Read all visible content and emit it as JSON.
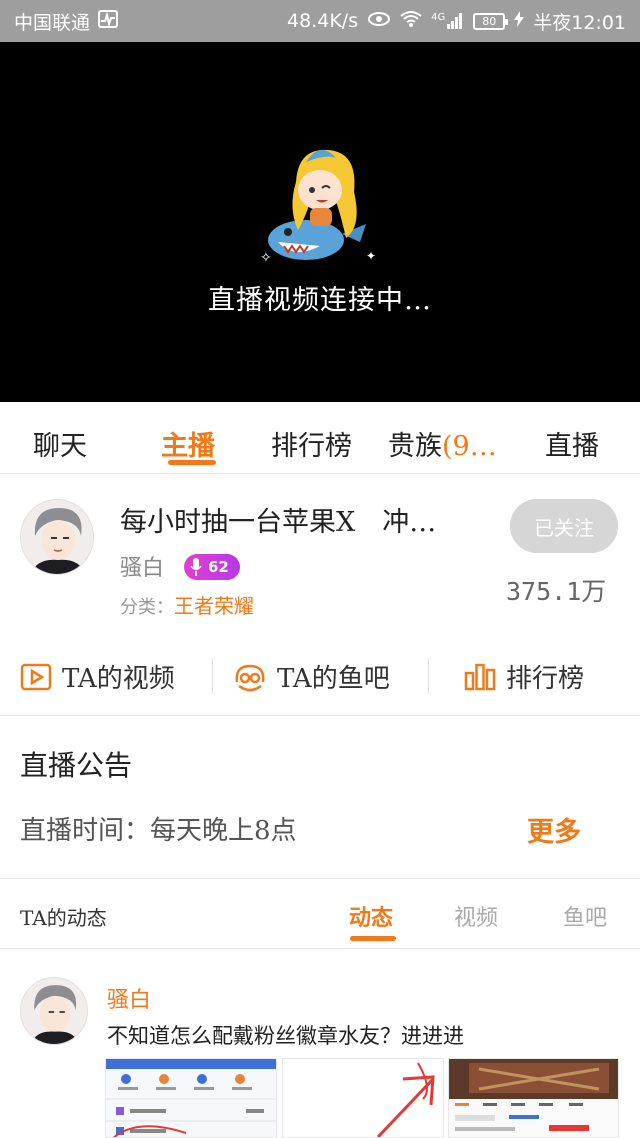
{
  "status_bar": {
    "carrier": "中国联通",
    "speed": "48.4K/s",
    "network": "4G",
    "battery": "80",
    "time": "半夜12:01"
  },
  "video": {
    "loading_text": "直播视频连接中…"
  },
  "tabs": [
    {
      "label": "聊天"
    },
    {
      "label": "主播"
    },
    {
      "label": "排行榜"
    },
    {
      "label": "贵族",
      "suffix": "(9…"
    },
    {
      "label": "直播"
    }
  ],
  "anchor": {
    "title": "每小时抽一台苹果X　冲…",
    "name": "骚白",
    "level": "62",
    "category_label": "分类：",
    "category_value": "王者荣耀",
    "follow_label": "已关注",
    "fans": "375.1万"
  },
  "actions": [
    {
      "label": "TA的视频",
      "icon": "video-icon"
    },
    {
      "label": "TA的鱼吧",
      "icon": "fishbar-icon"
    },
    {
      "label": "排行榜",
      "icon": "rank-icon"
    }
  ],
  "notice": {
    "title": "直播公告",
    "body": "直播时间：每天晚上8点",
    "more": "更多"
  },
  "dynamics": {
    "title": "TA的动态",
    "tabs": [
      "动态",
      "视频",
      "鱼吧"
    ]
  },
  "post": {
    "author": "骚白",
    "text": "不知道怎么配戴粉丝徽章水友？进进进"
  },
  "colors": {
    "accent": "#f07a1a",
    "status_bar": "#9e9e9e",
    "badge": "#d13ee0"
  }
}
